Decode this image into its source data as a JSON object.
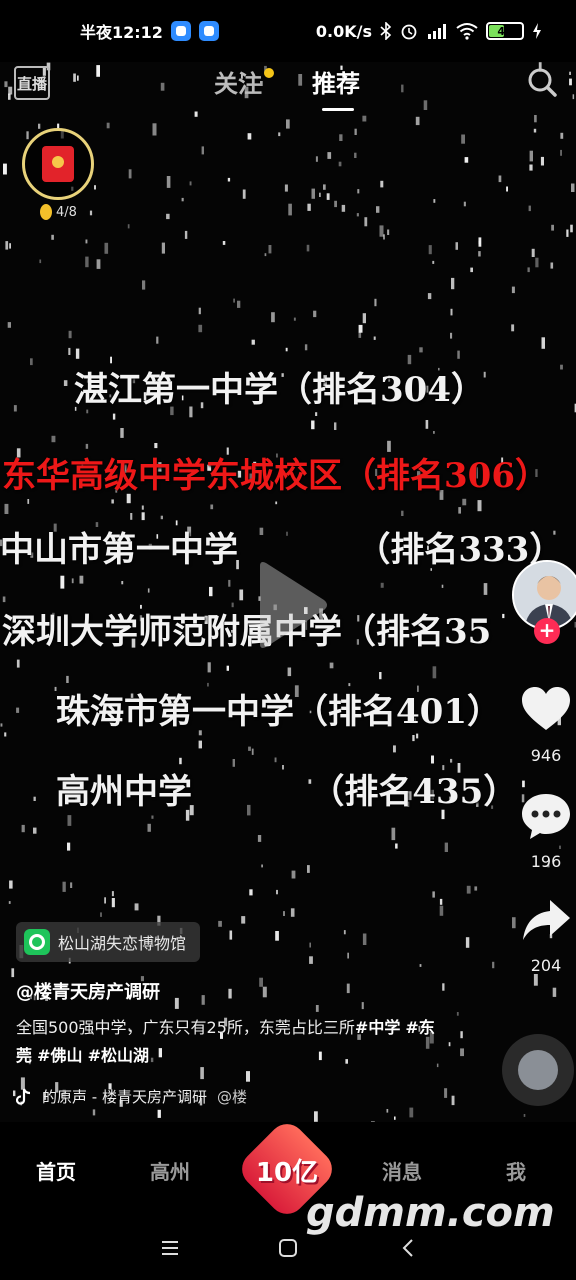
{
  "status_bar": {
    "time": "半夜12:12",
    "net_speed": "0.0K/s",
    "battery": "43"
  },
  "top_nav": {
    "live_label": "直播",
    "tab_follow": "关注",
    "tab_recommend": "推荐"
  },
  "reward": {
    "progress": "4/8"
  },
  "video_text": [
    {
      "text": "湛江第一中学（排名304）",
      "color": "white"
    },
    {
      "text": "东华高级中学东城校区（排名306）",
      "color": "red"
    },
    {
      "text": "中山市第一中学          （排名333）",
      "color": "white"
    },
    {
      "text": "深圳大学师范附属中学（排名35",
      "color": "white"
    },
    {
      "text": "珠海市第一中学（排名401）",
      "color": "white"
    },
    {
      "text": "高州中学          （排名435）",
      "color": "white"
    }
  ],
  "rail": {
    "likes": "946",
    "comments": "196",
    "shares": "204"
  },
  "caption": {
    "location": "松山湖失恋博物馆",
    "author": "@楼青天房产调研",
    "desc_text": "全国500强中学，广东只有25所，东莞占比三所",
    "tags": [
      "#中学",
      "#东莞",
      "#佛山",
      "#松山湖"
    ],
    "music": "的原声 - 楼青天房产调研",
    "music_at": "@楼"
  },
  "bottom_nav": {
    "home": "首页",
    "local": "高州",
    "center_badge": "10亿",
    "messages": "消息",
    "me": "我"
  },
  "watermark": "gdmm.com",
  "colors": {
    "accent_red": "#fe2c55",
    "location_green": "#1ec45a",
    "follow_dot": "#f5c518"
  }
}
